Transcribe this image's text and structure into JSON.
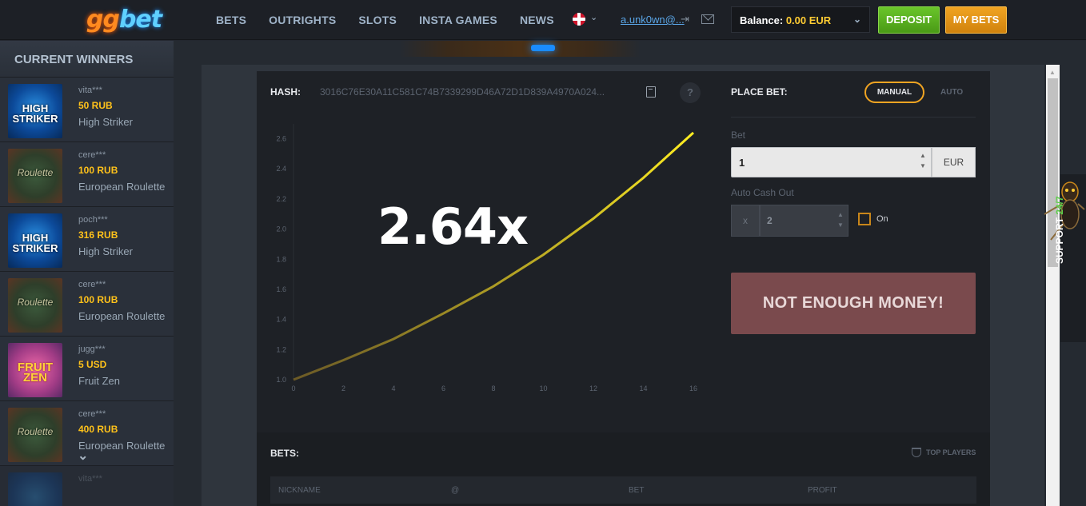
{
  "header": {
    "logo_gg": "gg",
    "logo_bet": "bet",
    "nav": [
      "BETS",
      "OUTRIGHTS",
      "SLOTS",
      "INSTA GAMES",
      "NEWS"
    ],
    "user": "a.unk0wn@...",
    "balance_label": "Balance:",
    "balance_value": "0.00 EUR",
    "deposit": "DEPOSIT",
    "my_bets": "MY BETS"
  },
  "sidebar": {
    "title": "CURRENT WINNERS",
    "winners": [
      {
        "name": "vita***",
        "amount": "50 RUB",
        "game": "High Striker",
        "thumb": "HIGH STRIKER"
      },
      {
        "name": "cere***",
        "amount": "100 RUB",
        "game": "European Roulette",
        "thumb": "Roulette"
      },
      {
        "name": "poch***",
        "amount": "316 RUB",
        "game": "High Striker",
        "thumb": "HIGH STRIKER"
      },
      {
        "name": "cere***",
        "amount": "100 RUB",
        "game": "European Roulette",
        "thumb": "Roulette"
      },
      {
        "name": "jugg***",
        "amount": "5 USD",
        "game": "Fruit Zen",
        "thumb": "FRUIT ZEN"
      },
      {
        "name": "cere***",
        "amount": "400 RUB",
        "game": "European Roulette",
        "thumb": "Roulette"
      },
      {
        "name": "vita***",
        "amount": "",
        "game": "",
        "thumb": ""
      }
    ]
  },
  "game": {
    "hash_label": "HASH:",
    "hash_value": "3016C76E30A11C581C74B7339299D46A72D1D839A4970A024...",
    "multiplier": "2.64x"
  },
  "chart_data": {
    "type": "line",
    "x_ticks": [
      0,
      2,
      4,
      6,
      8,
      10,
      12,
      14,
      16
    ],
    "y_ticks": [
      "1.0",
      "1.2",
      "1.4",
      "1.6",
      "1.8",
      "2.0",
      "2.2",
      "2.4",
      "2.6"
    ],
    "xlim": [
      0,
      16
    ],
    "ylim": [
      1.0,
      2.64
    ],
    "series": [
      {
        "x": [
          0,
          2,
          4,
          6,
          8,
          10,
          12,
          14,
          16
        ],
        "y": [
          1.0,
          1.13,
          1.27,
          1.44,
          1.62,
          1.83,
          2.07,
          2.34,
          2.64
        ]
      }
    ],
    "line_color_start": "#6b5a26",
    "line_color_end": "#ffee22"
  },
  "place_bet": {
    "label": "PLACE BET:",
    "mode_manual": "MANUAL",
    "mode_auto": "AUTO",
    "bet_label": "Bet",
    "bet_value": "1",
    "currency": "EUR",
    "auto_cashout_label": "Auto Cash Out",
    "auto_cashout_prefix": "x",
    "auto_cashout_value": "2",
    "on_label": "On",
    "action": "NOT ENOUGH MONEY!"
  },
  "bets": {
    "label": "BETS:",
    "top_players": "TOP PLAYERS",
    "columns": [
      "NICKNAME",
      "@",
      "BET",
      "PROFIT"
    ]
  },
  "support": {
    "label": "SUPPORT",
    "hours": "24/7"
  }
}
